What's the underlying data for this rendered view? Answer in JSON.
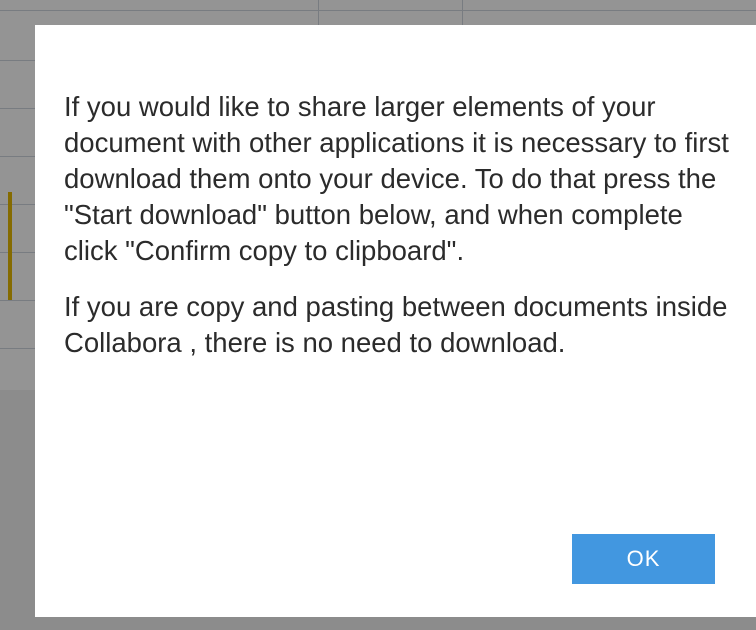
{
  "dialog": {
    "paragraph_1": "If you would like to share larger elements of your document with other applications it is necessary to first download them onto your device. To do that press the \"Start download\" button below, and when complete click \"Confirm copy to clipboard\".",
    "paragraph_2": "If you are copy and pasting between documents inside  Collabora , there is no need to download.",
    "ok_label": "OK"
  },
  "colors": {
    "button": "#4297e0",
    "overlay": "#8f8f8f",
    "selection": "#e6b800"
  }
}
